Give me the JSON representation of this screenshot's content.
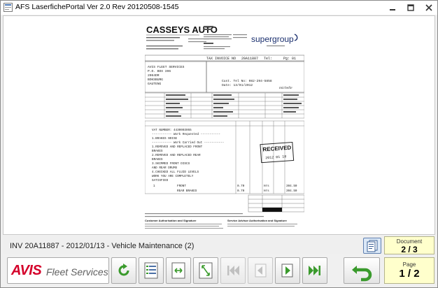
{
  "window": {
    "title": "AFS LaserfichePortal Ver 2.0 Rev 20120508-1545",
    "controls": [
      "minimize-icon",
      "maximize-icon",
      "close-icon"
    ]
  },
  "document": {
    "caption": "INV 20A11887 - 2012/01/13 - Vehicle Maintenance (2)",
    "invoice": {
      "company": "CASSEYS AUTO",
      "brand": "supergroup",
      "invoice_no_label": "TAX INVOICE NO",
      "invoice_no": "20A11887",
      "tel_label": "Tel:",
      "page_label": "Pg:",
      "page": "01",
      "account_lines": [
        "AVIS FLEET SERVICES",
        "P.O. BOX 396",
        "2064DR",
        "BOKSBURG",
        "GAUTENG"
      ],
      "cust_ref": "Cust. Tel No: 082-294-5858",
      "date_line": "Date: 13/01/2012",
      "signature": "michelle",
      "work_lines": [
        "VAT NUMBER: 4430003055",
        "----------- Work Requested -----------",
        "1.BRAKES NOISE",
        "----------- Work Carried Out -----------",
        "1.REMOVED AND REPLACED FRONT",
        "  BRAKES",
        "2.REMOVED AND REPLACED REAR",
        "  BRAKES",
        "3.SKIMMED FRONT DISCS",
        "  AND REAR DRUMS",
        "4.CHECKED ALL FLUID LEVELS",
        "WORK YOU ARE COMPLETELY",
        "SATISFIED"
      ],
      "line_items": [
        {
          "qty": "1",
          "desc": "FRONT",
          "amount": "0.70",
          "unit": "Hrs",
          "total": "304.50"
        },
        {
          "qty": "",
          "desc": "REAR BRAKES",
          "amount": "0.70",
          "unit": "Hrs",
          "total": "304.50"
        }
      ],
      "stamp": "RECEIVED",
      "stamp_date": "2012 01 18",
      "footer_title": "Customer Authorisation and Signature",
      "footer_right": "Service Advisor Authorisation and Signature"
    }
  },
  "document_counter": {
    "label": "Document",
    "value": "2 / 3"
  },
  "page_counter": {
    "label": "Page",
    "value": "1 / 2"
  },
  "logo": {
    "brand": "AVIS",
    "product": "Fleet Services"
  },
  "colors": {
    "avis_red": "#d4002a",
    "counter_bg": "#ffffcc",
    "nav_green": "#3a9a2c"
  },
  "toolbar": {
    "buttons": [
      "refresh-icon",
      "index-list-icon",
      "fit-page-icon",
      "fit-width-icon",
      "first-page-icon",
      "previous-page-icon",
      "next-page-icon",
      "last-page-icon",
      "back-icon"
    ]
  }
}
